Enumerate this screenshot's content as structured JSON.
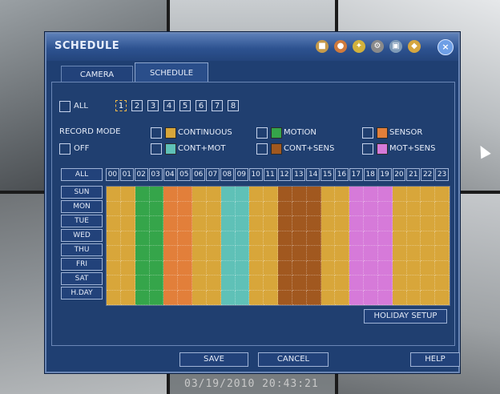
{
  "window": {
    "title": "SCHEDULE"
  },
  "tabs": [
    {
      "label": "CAMERA"
    },
    {
      "label": "SCHEDULE"
    }
  ],
  "all_label": "ALL",
  "cameras": [
    "1",
    "2",
    "3",
    "4",
    "5",
    "6",
    "7",
    "8"
  ],
  "selected_camera": "1",
  "record_mode": {
    "label": "RECORD MODE",
    "off_label": "OFF",
    "modes": [
      {
        "label": "CONTINUOUS",
        "color": "#d8a63a"
      },
      {
        "label": "MOTION",
        "color": "#35a54a"
      },
      {
        "label": "SENSOR",
        "color": "#e27f3a"
      },
      {
        "label": "CONT+MOT",
        "color": "#5fc1b7"
      },
      {
        "label": "CONT+SENS",
        "color": "#a1581f"
      },
      {
        "label": "MOT+SENS",
        "color": "#d67ad9"
      }
    ]
  },
  "grid": {
    "all_label": "ALL",
    "hours": [
      "00",
      "01",
      "02",
      "03",
      "04",
      "05",
      "06",
      "07",
      "08",
      "09",
      "10",
      "11",
      "12",
      "13",
      "14",
      "15",
      "16",
      "17",
      "18",
      "19",
      "20",
      "21",
      "22",
      "23"
    ],
    "days": [
      "SUN",
      "MON",
      "TUE",
      "WED",
      "THU",
      "FRI",
      "SAT",
      "H.DAY"
    ],
    "hour_modes": [
      "CONTINUOUS",
      "CONTINUOUS",
      "MOTION",
      "MOTION",
      "SENSOR",
      "SENSOR",
      "CONTINUOUS",
      "CONTINUOUS",
      "CONT+MOT",
      "CONT+MOT",
      "CONTINUOUS",
      "CONTINUOUS",
      "CONT+SENS",
      "CONT+SENS",
      "CONT+SENS",
      "CONTINUOUS",
      "CONTINUOUS",
      "MOT+SENS",
      "MOT+SENS",
      "MOT+SENS",
      "CONTINUOUS",
      "CONTINUOUS",
      "CONTINUOUS",
      "CONTINUOUS"
    ]
  },
  "buttons": {
    "holiday_setup": "HOLIDAY SETUP",
    "save": "SAVE",
    "cancel": "CANCEL",
    "help": "HELP"
  },
  "timestamp": "03/19/2010 20:43:21"
}
